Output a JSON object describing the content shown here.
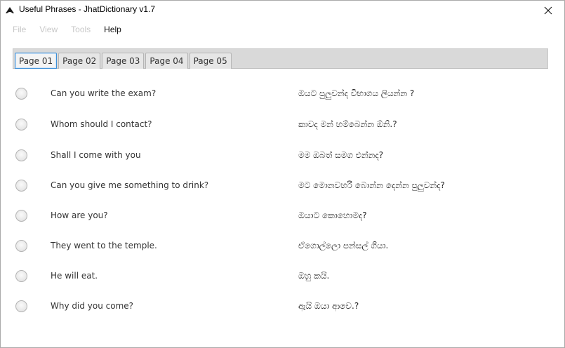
{
  "window": {
    "title": "Useful Phrases - JhatDictionary v1.7"
  },
  "icons": {
    "app": "app-logo-icon",
    "close": "close-icon"
  },
  "menu": {
    "items": [
      {
        "label": "File",
        "enabled": false
      },
      {
        "label": "View",
        "enabled": false
      },
      {
        "label": "Tools",
        "enabled": false
      },
      {
        "label": "Help",
        "enabled": true
      }
    ]
  },
  "tabs": [
    {
      "label": "Page 01",
      "selected": true
    },
    {
      "label": "Page 02",
      "selected": false
    },
    {
      "label": "Page 03",
      "selected": false
    },
    {
      "label": "Page 04",
      "selected": false
    },
    {
      "label": "Page 05",
      "selected": false
    }
  ],
  "phrases": [
    {
      "english": "Can you write the exam?",
      "sinhala": "ඔයට පුලුවන්ද විභාගය ලියන්න ?"
    },
    {
      "english": "Whom should I contact?",
      "sinhala": "කාවද මන් හම්බෙන්න ඕනි.?"
    },
    {
      "english": "Shall I come with you",
      "sinhala": "මම ඔබත් සමග එන්නද?"
    },
    {
      "english": "Can you give me something to drink?",
      "sinhala": "මට මොනවහරි බොන්න දෙන්න පුලුවන්ද?"
    },
    {
      "english": "How are you?",
      "sinhala": "ඔයාට කොහොමද?"
    },
    {
      "english": "They went to the temple.",
      "sinhala": "ඒගොල්ලො පන්සල් ගියා."
    },
    {
      "english": "He will eat.",
      "sinhala": "ඔහු කයි."
    },
    {
      "english": "Why did you come?",
      "sinhala": "ඇයි ඔයා ආවෙ.?"
    }
  ]
}
